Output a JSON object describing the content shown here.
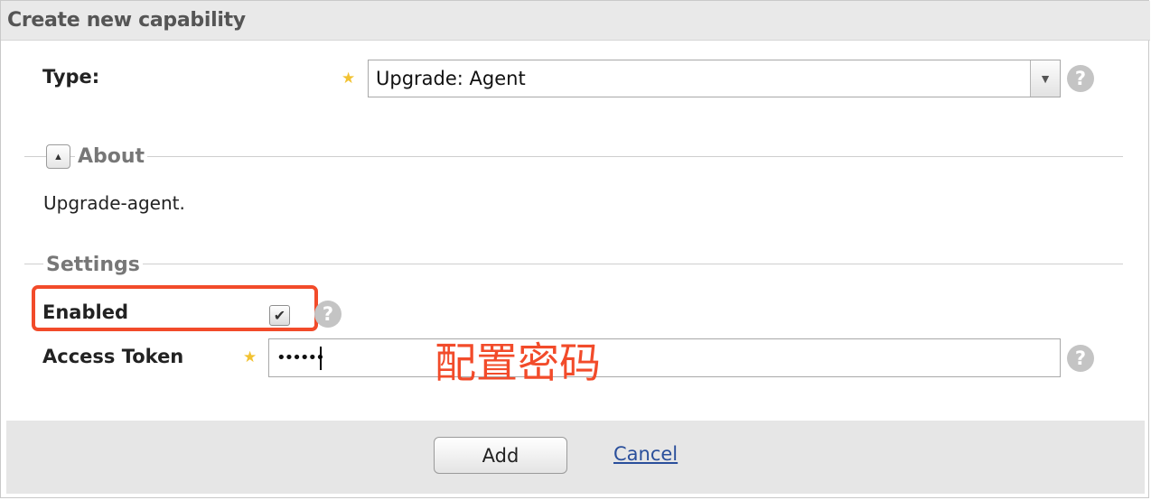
{
  "dialog": {
    "title": "Create new capability"
  },
  "type_field": {
    "label": "Type:",
    "required_marker": "★",
    "value": "Upgrade: Agent",
    "arrow": "▼",
    "help": "?"
  },
  "about": {
    "section_title": "About",
    "collapse_glyph": "▲",
    "text": "Upgrade-agent."
  },
  "settings": {
    "section_title": "Settings",
    "enabled": {
      "label": "Enabled",
      "checked": true,
      "check_glyph": "✔",
      "help": "?"
    },
    "access_token": {
      "label": "Access Token",
      "required_marker": "★",
      "value": "••••••",
      "help": "?"
    }
  },
  "annotation": {
    "text": "配置密码",
    "color": "#f24b2a"
  },
  "footer": {
    "add_label": "Add",
    "cancel_label": "Cancel"
  }
}
